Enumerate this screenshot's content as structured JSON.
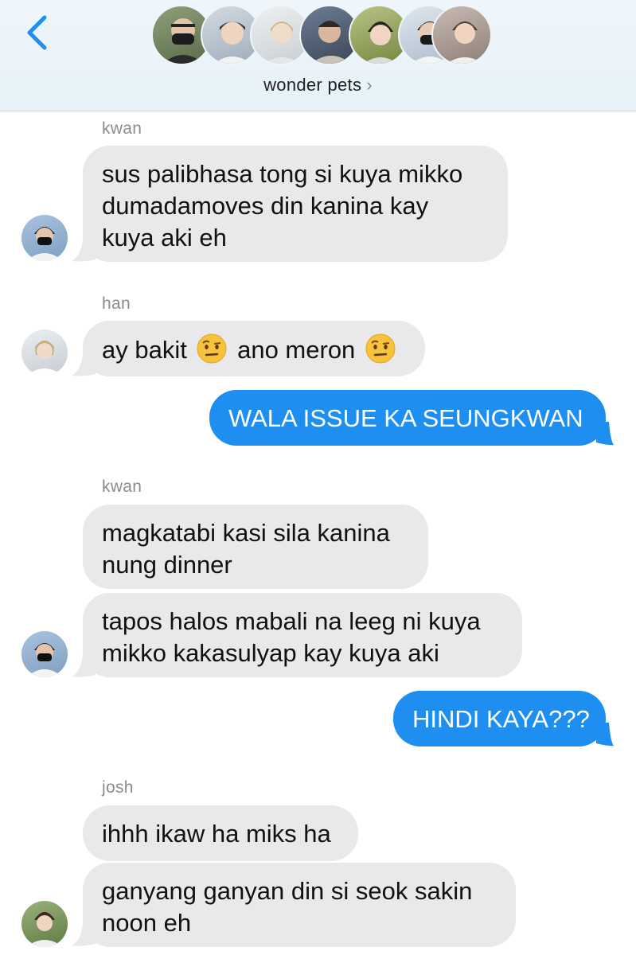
{
  "header": {
    "group_name": "wonder pets",
    "chevron": "›",
    "avatars": [
      {
        "icon": "avatar-1",
        "bg": "#6b7d58"
      },
      {
        "icon": "avatar-2",
        "bg": "#b8c3cf"
      },
      {
        "icon": "avatar-3",
        "bg": "#d8dde0"
      },
      {
        "icon": "avatar-4",
        "bg": "#4d5a6b"
      },
      {
        "icon": "avatar-5",
        "bg": "#9aa86a"
      },
      {
        "icon": "avatar-6",
        "bg": "#c9d3de"
      },
      {
        "icon": "avatar-7",
        "bg": "#b0a29a"
      }
    ]
  },
  "messages": [
    {
      "sender": "kwan",
      "lines": [
        "sus palibhasa tong si kuya mikko",
        "dumadamoves din kanina kay",
        "kuya aki eh"
      ]
    },
    {
      "sender": "han",
      "text_1": "ay bakit",
      "text_2": "ano meron"
    },
    {
      "outgoing": "WALA ISSUE KA SEUNGKWAN"
    },
    {
      "sender": "kwan",
      "lines": [
        "magkatabi kasi sila kanina",
        "nung dinner"
      ]
    },
    {
      "lines": [
        "tapos halos mabali na leeg ni kuya",
        "mikko kakasulyap kay kuya aki"
      ]
    },
    {
      "outgoing": "HINDI KAYA???"
    },
    {
      "sender": "josh",
      "lines": [
        "ihhh ikaw ha miks ha"
      ]
    },
    {
      "lines": [
        "ganyang ganyan din si seok sakin",
        "noon eh"
      ]
    }
  ],
  "colors": {
    "incoming_bubble": "#e9e9eb",
    "outgoing_bubble": "#1e8ff0",
    "accent": "#1e8ff0"
  }
}
